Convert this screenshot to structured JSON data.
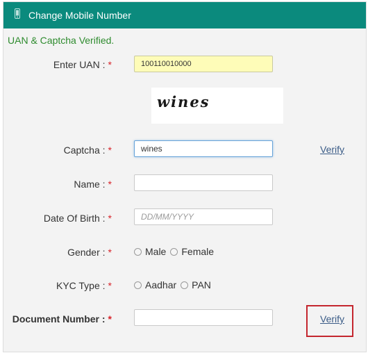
{
  "header": {
    "title": "Change Mobile Number",
    "icon": "mobile-phone-icon"
  },
  "status": {
    "message": "UAN & Captcha Verified."
  },
  "form": {
    "uan": {
      "label": "Enter UAN :",
      "value": "100110010000"
    },
    "captcha_image": {
      "text": "wines"
    },
    "captcha": {
      "label": "Captcha :",
      "value": "wines"
    },
    "name": {
      "label": "Name :",
      "value": ""
    },
    "dob": {
      "label": "Date Of Birth :",
      "placeholder": "DD/MM/YYYY"
    },
    "gender": {
      "label": "Gender :",
      "options": [
        "Male",
        "Female"
      ]
    },
    "kyc_type": {
      "label": "KYC Type :",
      "options": [
        "Aadhar",
        "PAN"
      ]
    },
    "document_number": {
      "label": "Document Number :",
      "value": ""
    },
    "required_mark": "*"
  },
  "links": {
    "verify_captcha": "Verify",
    "verify_document": "Verify"
  },
  "colors": {
    "header": "#0b8a7d",
    "success": "#2e8b2e",
    "required": "#d8232a",
    "highlight": "#c4262e"
  }
}
